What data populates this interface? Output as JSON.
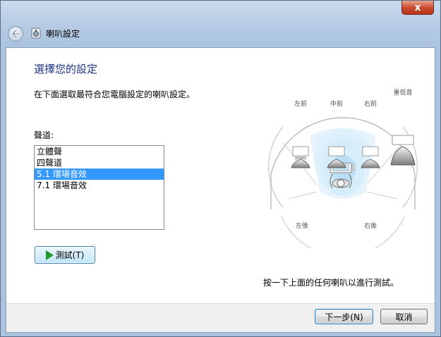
{
  "window": {
    "title": "喇叭設定",
    "close_glyph": "x"
  },
  "page": {
    "heading": "選擇您的設定",
    "description": "在下面選取最符合您電腦設定的喇叭設定。",
    "channels_label": "聲道:",
    "channels": [
      "立體聲",
      "四聲道",
      "5.1 環場音效",
      "7.1 環場音效"
    ],
    "selected_channel": "5.1 環場音效",
    "test_button": "測試(T)",
    "hint": "按一下上面的任何喇叭以進行測試。"
  },
  "speakers": {
    "front_left": "左前",
    "center": "中前",
    "front_right": "右前",
    "subwoofer": "重低音",
    "rear_left": "左後",
    "rear_right": "右後"
  },
  "footer": {
    "next_button": "下一步(N)",
    "cancel_button": "取消"
  },
  "colors": {
    "selection": "#3399ff",
    "heading": "#1e3287",
    "play": "#1e9a2a"
  }
}
